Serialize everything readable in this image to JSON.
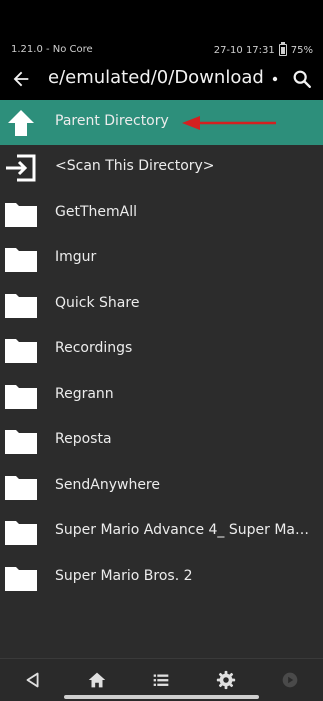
{
  "status": {
    "left_text": "1.21.0 - No Core",
    "datetime": "27-10 17:31",
    "battery": "75%"
  },
  "toolbar": {
    "path": "e/emulated/0/Download",
    "back_icon": "back-arrow-icon",
    "more_icon": "more-dot-icon",
    "search_icon": "search-icon"
  },
  "list": {
    "items": [
      {
        "label": "Parent Directory",
        "icon": "up-arrow-icon",
        "selected": true
      },
      {
        "label": "<Scan This Directory>",
        "icon": "scan-enter-icon",
        "selected": false
      },
      {
        "label": "GetThemAll",
        "icon": "folder-icon",
        "selected": false
      },
      {
        "label": "Imgur",
        "icon": "folder-icon",
        "selected": false
      },
      {
        "label": "Quick Share",
        "icon": "folder-icon",
        "selected": false
      },
      {
        "label": "Recordings",
        "icon": "folder-icon",
        "selected": false
      },
      {
        "label": "Regrann",
        "icon": "folder-icon",
        "selected": false
      },
      {
        "label": "Reposta",
        "icon": "folder-icon",
        "selected": false
      },
      {
        "label": "SendAnywhere",
        "icon": "folder-icon",
        "selected": false
      },
      {
        "label": "Super Mario Advance 4_ Super Mario...",
        "icon": "folder-icon",
        "selected": false
      },
      {
        "label": "Super Mario Bros. 2",
        "icon": "folder-icon",
        "selected": false
      }
    ]
  },
  "navbar": {
    "buttons": [
      "triangle-back-icon",
      "home-icon",
      "list-icon",
      "gear-icon",
      "circle-play-icon"
    ]
  },
  "colors": {
    "selected_row": "#2d8f7b",
    "list_background": "#2c2c2c",
    "annotation_arrow": "#d42020"
  }
}
